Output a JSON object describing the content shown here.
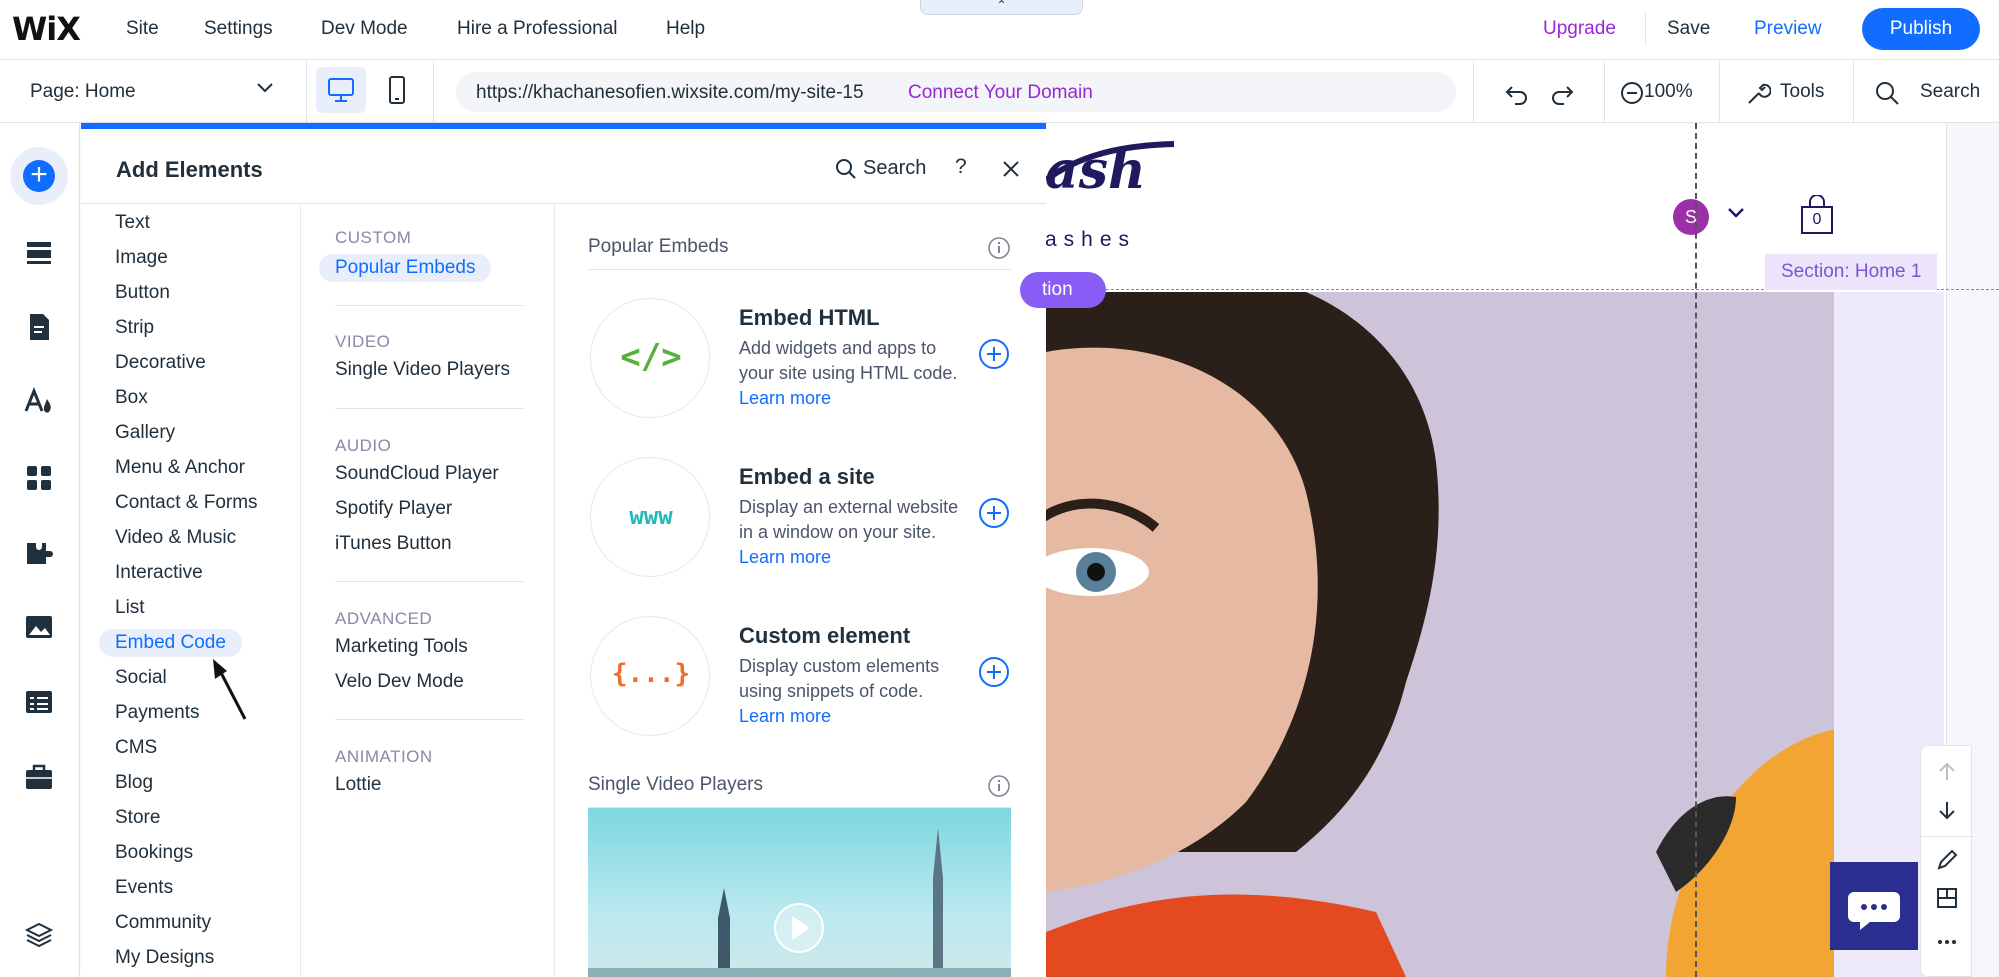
{
  "topbar": {
    "logo": "WiX",
    "menu": [
      "Site",
      "Settings",
      "Dev Mode",
      "Hire a Professional",
      "Help"
    ],
    "upgrade": "Upgrade",
    "save": "Save",
    "preview": "Preview",
    "publish": "Publish"
  },
  "bar2": {
    "page_selector": "Page: Home",
    "url": "https://khachanesofien.wixsite.com/my-site-15",
    "connect_domain": "Connect Your Domain",
    "zoom": "100%",
    "tools": "Tools",
    "search": "Search"
  },
  "panel": {
    "title": "Add Elements",
    "search": "Search",
    "help": "?",
    "categories": [
      "Text",
      "Image",
      "Button",
      "Strip",
      "Decorative",
      "Box",
      "Gallery",
      "Menu & Anchor",
      "Contact & Forms",
      "Video & Music",
      "Interactive",
      "List",
      "Embed Code",
      "Social",
      "Payments",
      "CMS",
      "Blog",
      "Store",
      "Bookings",
      "Events",
      "Community",
      "My Designs"
    ],
    "active_category": "Embed Code",
    "subcategories": {
      "custom_heading": "CUSTOM",
      "custom": [
        "Popular Embeds"
      ],
      "video_heading": "VIDEO",
      "video": [
        "Single Video Players"
      ],
      "audio_heading": "AUDIO",
      "audio": [
        "SoundCloud Player",
        "Spotify Player",
        "iTunes Button"
      ],
      "advanced_heading": "ADVANCED",
      "advanced": [
        "Marketing Tools",
        "Velo Dev Mode"
      ],
      "animation_heading": "ANIMATION",
      "animation": [
        "Lottie"
      ]
    },
    "sections": {
      "popular_embeds": "Popular Embeds",
      "single_video_players": "Single Video Players"
    },
    "items": [
      {
        "name": "Embed HTML",
        "glyph": "</>",
        "glyph_color": "#56b13c",
        "desc": "Add widgets and apps to your site using HTML code.",
        "link": "Learn more"
      },
      {
        "name": "Embed a site",
        "glyph": "www",
        "glyph_color": "#25b8b8",
        "desc": "Display an external website in a window on your site.",
        "link": "Learn more"
      },
      {
        "name": "Custom element",
        "glyph": "{...}",
        "glyph_color": "#f26b2a",
        "desc": "Display custom elements using snippets of code.",
        "link": "Learn more"
      }
    ]
  },
  "canvas": {
    "logo_script": "ash",
    "logo_sub": "ashes",
    "avatar_letter": "S",
    "cart_count": "0",
    "section_tag": "Section: Home 1",
    "section_pill": "tion"
  },
  "colors": {
    "accent": "#116dff",
    "upgrade": "#9a27d5",
    "section": "#8a5cf6"
  }
}
